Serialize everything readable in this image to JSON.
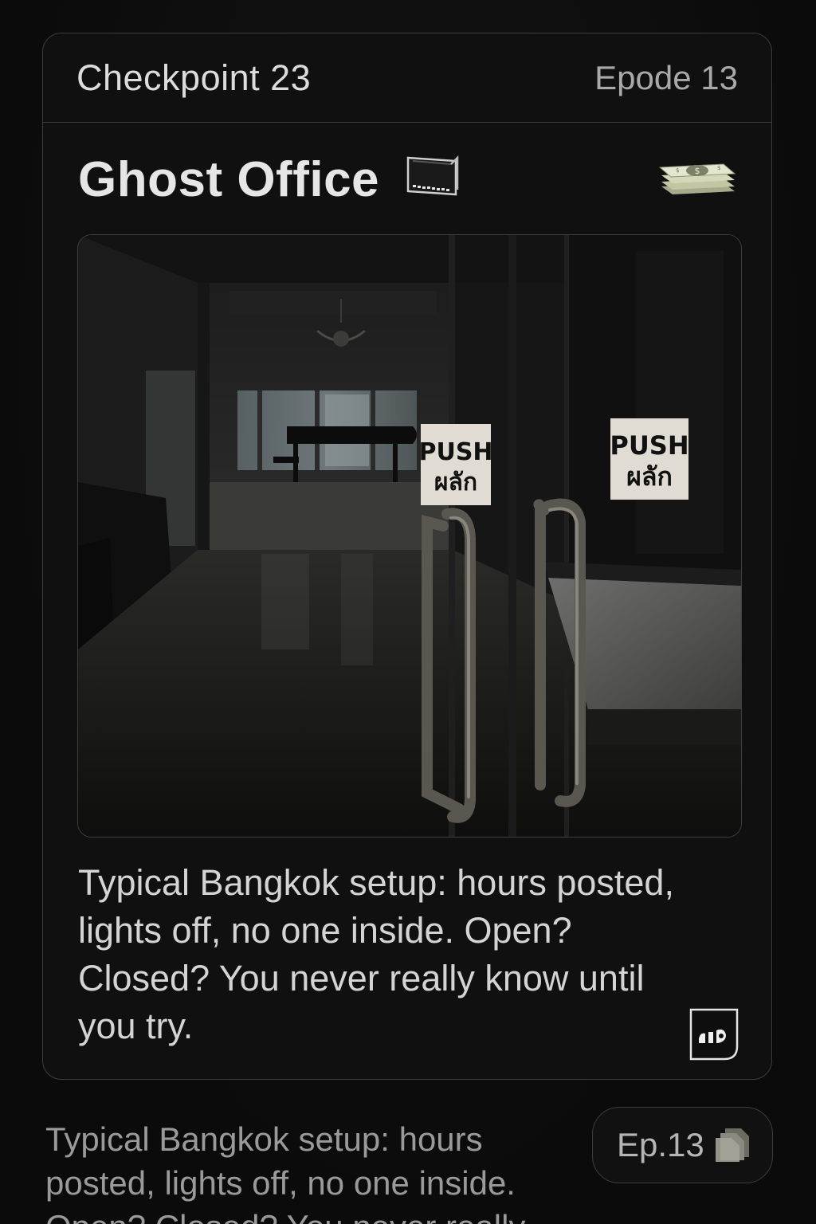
{
  "header": {
    "checkpoint": "Checkpoint 23",
    "episode": "Epode 13"
  },
  "post": {
    "title": "Ghost Office",
    "title_icon": "laptop-icon",
    "reward_icon": "cash-stack-icon",
    "photo": {
      "sign_left_line1": "PUSH",
      "sign_left_line2": "ผลัก",
      "sign_right_line1": "PUSH",
      "sign_right_line2": "ผลัก"
    },
    "caption": "Typical Bangkok setup: hours posted, lights off, no one inside. Open? Closed? You never really know until you try.",
    "badge_icon": "translate-badge-icon"
  },
  "footer": {
    "text": "Typical Bangkok setup: hours posted, lights off, no one inside. Open? Closed? You never really",
    "episode_pill": "Ep.13",
    "episode_pill_icon": "stack-icon"
  },
  "colors": {
    "background": "#0b0b0b",
    "card": "#101010",
    "border": "#3d3d3d",
    "text_primary": "#e6e6e6",
    "text_secondary": "#a9a9a9"
  }
}
